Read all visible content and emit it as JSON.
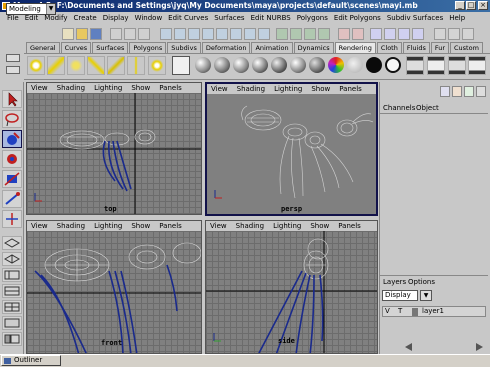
{
  "window": {
    "title": "Maya 4.5: F:\\Documents and Settings\\jyq\\My Documents\\maya\\projects\\default\\scenes\\mayi.mb",
    "minimize_glyph": "_",
    "maximize_glyph": "□",
    "close_glyph": "×"
  },
  "menubar": [
    "File",
    "Edit",
    "Modify",
    "Create",
    "Display",
    "Window",
    "Edit Curves",
    "Surfaces",
    "Edit NURBS",
    "Polygons",
    "Edit Polygons",
    "Subdiv Surfaces",
    "Help"
  ],
  "statusline": {
    "mode": "Modeling",
    "dropdown_glyph": "▼"
  },
  "shelf": {
    "tabs": [
      "General",
      "Curves",
      "Surfaces",
      "Polygons",
      "Subdivs",
      "Deformation",
      "Animation",
      "Dynamics",
      "Rendering",
      "Cloth",
      "Fluids",
      "Fur",
      "Custom"
    ],
    "active_tab": "Rendering"
  },
  "viewports": [
    {
      "menu": [
        "View",
        "Shading",
        "Lighting",
        "Show",
        "Panels"
      ],
      "label": "top"
    },
    {
      "menu": [
        "View",
        "Shading",
        "Lighting",
        "Show",
        "Panels"
      ],
      "label": "persp"
    },
    {
      "menu": [
        "View",
        "Shading",
        "Lighting",
        "Show",
        "Panels"
      ],
      "label": "front"
    },
    {
      "menu": [
        "View",
        "Shading",
        "Lighting",
        "Show",
        "Panels"
      ],
      "label": "side"
    }
  ],
  "active_viewport": "persp",
  "axis": {
    "x": "x",
    "y": "y",
    "z": "z"
  },
  "channel_box": {
    "tabs": [
      "Channels",
      "Object"
    ]
  },
  "layers": {
    "menu": [
      "Layers",
      "Options"
    ],
    "display": "Display",
    "layer_v": "V",
    "layer_t": "T",
    "layer_name": "layer1"
  },
  "outliner": {
    "label": "Outliner"
  },
  "colors": {
    "wireframe_body": "#c8c8c8",
    "wireframe_legs": "#1a2a8c",
    "active_border": "#12124a",
    "title_bar": "#0a246a"
  }
}
